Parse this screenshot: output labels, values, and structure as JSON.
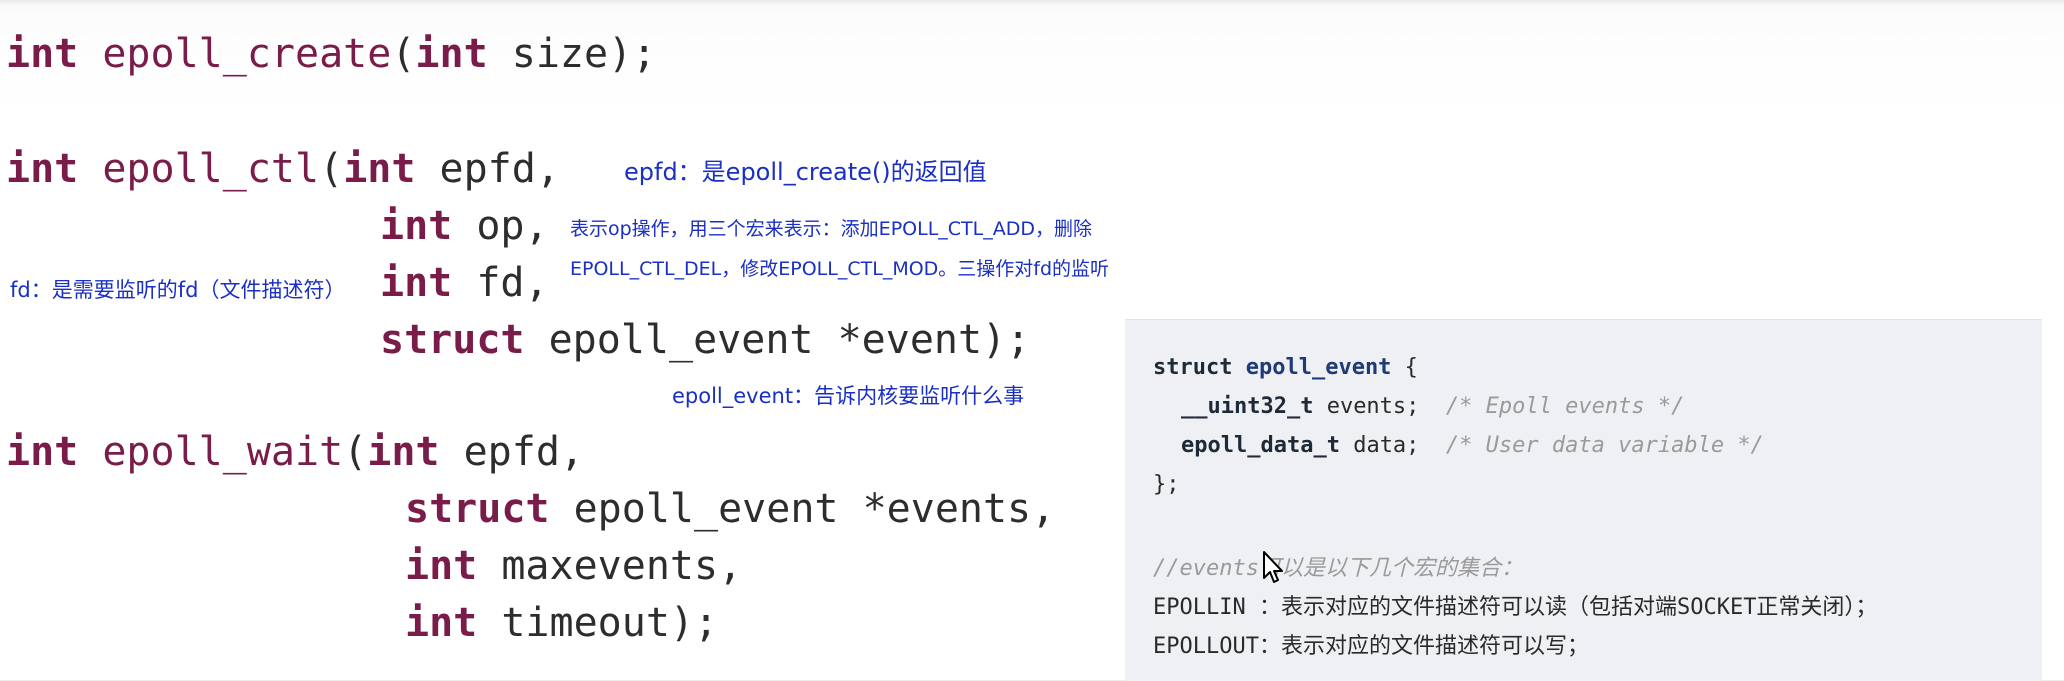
{
  "code": {
    "epoll_create": {
      "ret": "int",
      "name": "epoll_create",
      "rest": "(",
      "param_type": "int",
      "param_tail": " size);"
    },
    "epoll_ctl": {
      "ret": "int",
      "name": "epoll_ctl",
      "p1_type": "int",
      "p1": " epfd,",
      "p2_type": "int",
      "p2": " op,",
      "p3_type": "int",
      "p3": " fd,",
      "p4_type": "struct",
      "p4": " epoll_event *event);"
    },
    "epoll_wait": {
      "ret": "int",
      "name": "epoll_wait",
      "p1_type": "int",
      "p1": " epfd,",
      "p2_type": "struct",
      "p2": " epoll_event *events,",
      "p3_type": "int",
      "p3": " maxevents,",
      "p4_type": "int",
      "p4": " timeout);"
    }
  },
  "notes": {
    "epfd": "epfd：是epoll_create()的返回值",
    "op_line1": "表示op操作，用三个宏来表示：添加EPOLL_CTL_ADD，删除",
    "op_line2": "EPOLL_CTL_DEL，修改EPOLL_CTL_MOD。三操作对fd的监听",
    "fd": "fd：是需要监听的fd（文件描述符）",
    "event": "epoll_event：告诉内核要监听什么事"
  },
  "panel": {
    "struct_kw": "struct",
    "struct_name": "epoll_event",
    "struct_open": " {",
    "f1_type": "__uint32_t",
    "f1_name": " events;  ",
    "f1_comment": "/* Epoll events */",
    "f2_type": "epoll_data_t",
    "f2_name": " data;  ",
    "f2_comment": "/* User data variable */",
    "struct_close": "};",
    "comment_line": "//events可以是以下几个宏的集合：",
    "epollin": "EPOLLIN ：表示对应的文件描述符可以读（包括对端SOCKET正常关闭）；",
    "epollout": "EPOLLOUT：表示对应的文件描述符可以写；"
  },
  "colors": {
    "keyword": "#7a1c4a",
    "note": "#1a2fc4",
    "panel_bg": "#eef0f3"
  }
}
